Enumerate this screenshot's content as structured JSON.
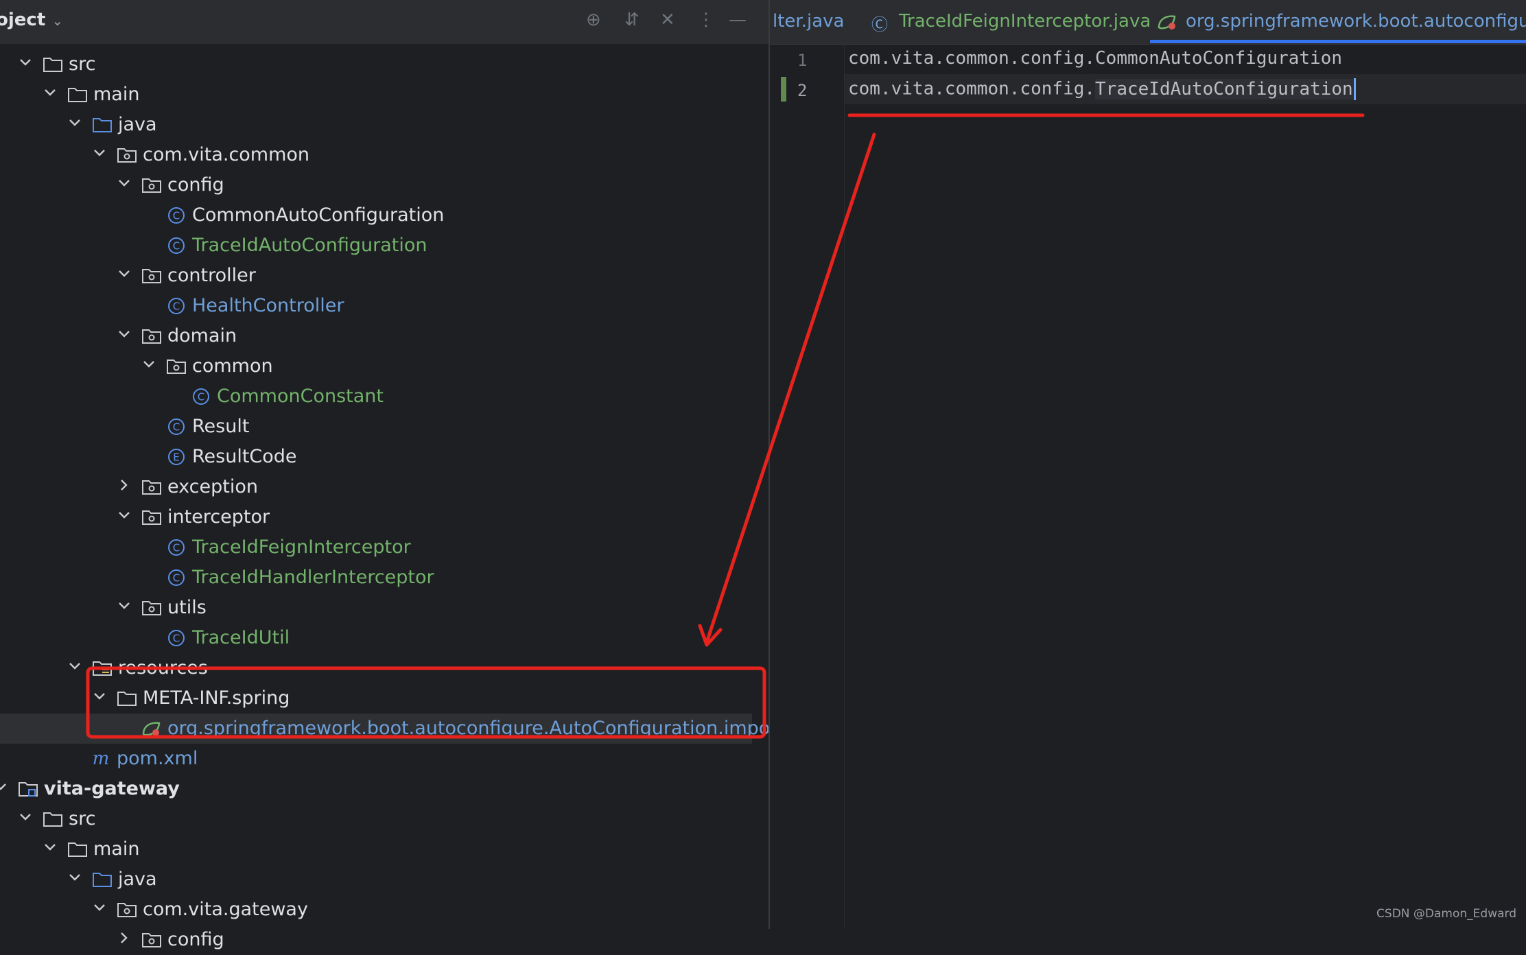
{
  "project_panel": {
    "title": "oject",
    "title_chevron_icon": "chevron-down-icon",
    "header_icons": [
      "crosshair-icon",
      "expand-collapse-icon",
      "close-icon",
      "more-vertical-icon",
      "minimize-icon"
    ]
  },
  "tree": {
    "rows": [
      {
        "label": "src",
        "kind": "folder",
        "expanded": true
      },
      {
        "label": "main",
        "kind": "folder",
        "expanded": true
      },
      {
        "label": "java",
        "kind": "source-folder",
        "expanded": true
      },
      {
        "label": "com.vita.common",
        "kind": "package",
        "expanded": true
      },
      {
        "label": "config",
        "kind": "package",
        "expanded": true
      },
      {
        "label": "CommonAutoConfiguration",
        "kind": "class",
        "color": "default"
      },
      {
        "label": "TraceIdAutoConfiguration",
        "kind": "class",
        "color": "green"
      },
      {
        "label": "controller",
        "kind": "package",
        "expanded": true
      },
      {
        "label": "HealthController",
        "kind": "class",
        "color": "blue"
      },
      {
        "label": "domain",
        "kind": "package",
        "expanded": true
      },
      {
        "label": "common",
        "kind": "package",
        "expanded": true
      },
      {
        "label": "CommonConstant",
        "kind": "class",
        "color": "green"
      },
      {
        "label": "Result",
        "kind": "class",
        "color": "default"
      },
      {
        "label": "ResultCode",
        "kind": "enum",
        "color": "default"
      },
      {
        "label": "exception",
        "kind": "package",
        "expanded": false
      },
      {
        "label": "interceptor",
        "kind": "package",
        "expanded": true
      },
      {
        "label": "TraceIdFeignInterceptor",
        "kind": "class",
        "color": "green"
      },
      {
        "label": "TraceIdHandlerInterceptor",
        "kind": "class",
        "color": "green"
      },
      {
        "label": "utils",
        "kind": "package",
        "expanded": true
      },
      {
        "label": "TraceIdUtil",
        "kind": "class",
        "color": "green"
      },
      {
        "label": "resources",
        "kind": "resources-folder",
        "expanded": true
      },
      {
        "label": "META-INF.spring",
        "kind": "folder",
        "expanded": true
      },
      {
        "label": "org.springframework.boot.autoconfigure.AutoConfiguration.imports",
        "kind": "spring-file",
        "color": "blue",
        "selected": true
      },
      {
        "label": "pom.xml",
        "kind": "maven",
        "color": "blue"
      },
      {
        "label": "vita-gateway",
        "kind": "module",
        "expanded": true,
        "bold": true
      },
      {
        "label": "src",
        "kind": "folder",
        "expanded": true
      },
      {
        "label": "main",
        "kind": "folder",
        "expanded": true
      },
      {
        "label": "java",
        "kind": "source-folder",
        "expanded": true
      },
      {
        "label": "com.vita.gateway",
        "kind": "package",
        "expanded": true
      },
      {
        "label": "config",
        "kind": "package",
        "expanded": false
      }
    ]
  },
  "editor": {
    "tabs": [
      {
        "label": "lter.java",
        "icon": "",
        "active": false
      },
      {
        "label": "TraceIdFeignInterceptor.java",
        "icon": "class-icon",
        "active": false
      },
      {
        "label": "org.springframework.boot.autoconfigure.Au",
        "icon": "spring-icon",
        "active": true
      }
    ],
    "line_numbers": [
      "1",
      "2"
    ],
    "lines": [
      "com.vita.common.config.CommonAutoConfiguration",
      "com.vita.common.config.TraceIdAutoConfiguration"
    ],
    "line2_prefix": "com.vita.common.config.",
    "line2_word": "TraceIdAutoConfiguration"
  },
  "annotations": {
    "color": "#e8231d",
    "arrow_from": "editor-line-2",
    "arrow_to": "tree-row-imports-file"
  },
  "colors": {
    "bg": "#1e1f22",
    "panel": "#2b2d30",
    "text": "#dfe1e5",
    "green": "#73b26b",
    "blue": "#6f9fd8",
    "accent": "#3574f0"
  },
  "watermark": "CSDN @Damon_Edward"
}
